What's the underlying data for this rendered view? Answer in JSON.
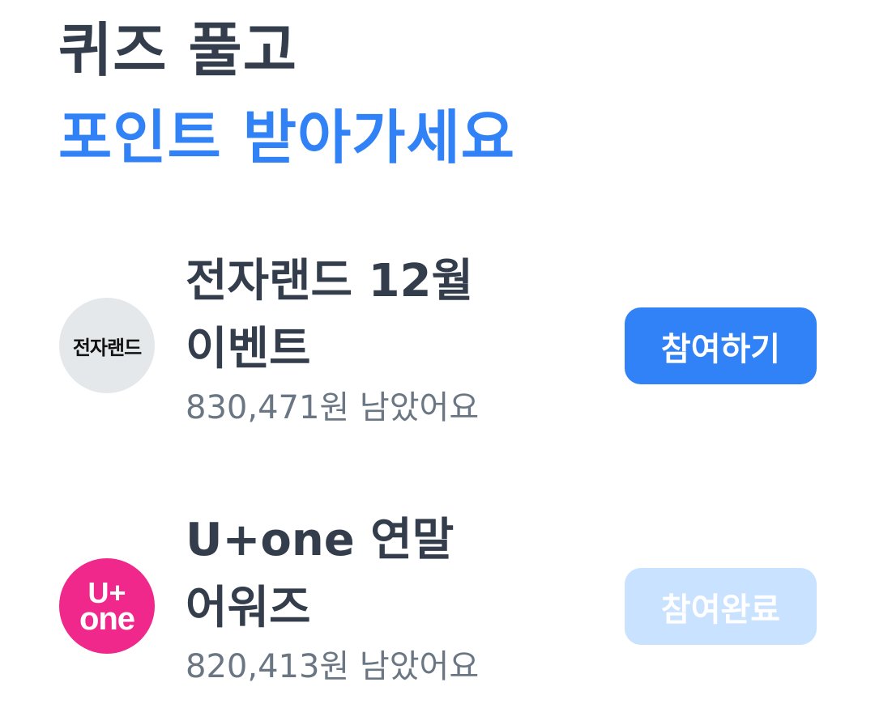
{
  "header": {
    "line1": "퀴즈 풀고",
    "line2": "포인트 받아가세요"
  },
  "quizzes": [
    {
      "logo_text": "전자랜드",
      "title_line1": "전자랜드 12월",
      "title_line2": "이벤트",
      "remaining": "830,471원 남았어요",
      "button_label": "참여하기"
    },
    {
      "logo_text_top": "U+",
      "logo_text_bottom": "one",
      "title_line1": "U+one 연말",
      "title_line2": "어워즈",
      "remaining": "820,413원 남았어요",
      "button_label": "참여완료"
    }
  ],
  "colors": {
    "brand_blue": "#3182f6",
    "completed_button": "#c9e2ff",
    "uplus_pink": "#f0288c",
    "title_text": "#333d4b",
    "sub_text": "#6b7684"
  }
}
